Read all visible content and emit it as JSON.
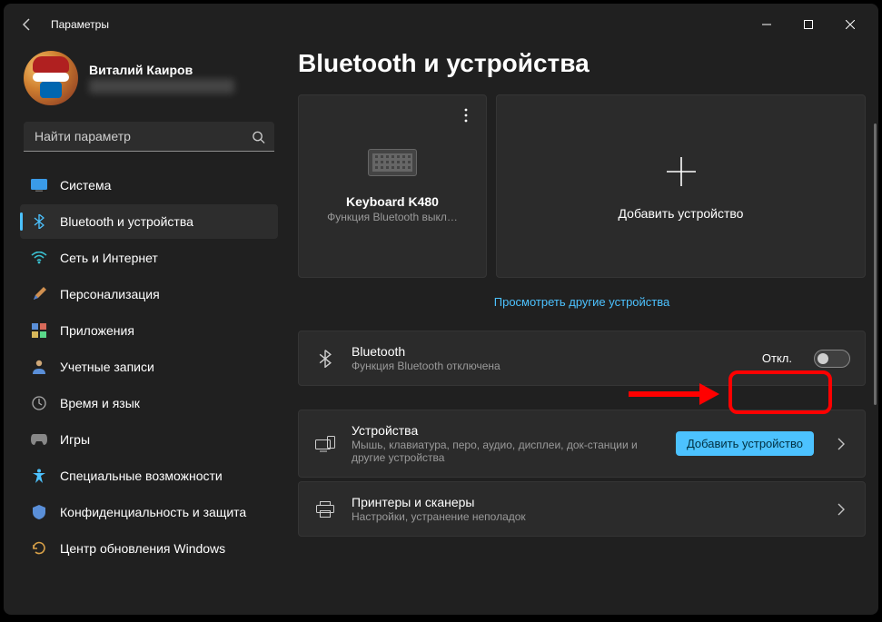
{
  "titlebar": {
    "title": "Параметры"
  },
  "profile": {
    "name": "Виталий Каиров"
  },
  "search": {
    "placeholder": "Найти параметр"
  },
  "sidebar": {
    "items": [
      {
        "label": "Система"
      },
      {
        "label": "Bluetooth и устройства"
      },
      {
        "label": "Сеть и Интернет"
      },
      {
        "label": "Персонализация"
      },
      {
        "label": "Приложения"
      },
      {
        "label": "Учетные записи"
      },
      {
        "label": "Время и язык"
      },
      {
        "label": "Игры"
      },
      {
        "label": "Специальные возможности"
      },
      {
        "label": "Конфиденциальность и защита"
      },
      {
        "label": "Центр обновления Windows"
      }
    ]
  },
  "page": {
    "title": "Bluetooth и устройства"
  },
  "device_card": {
    "name": "Keyboard K480",
    "sub": "Функция Bluetooth выкл…"
  },
  "add_card": {
    "label": "Добавить устройство"
  },
  "link": {
    "view_more": "Просмотреть другие устройства"
  },
  "bluetooth_row": {
    "title": "Bluetooth",
    "sub": "Функция Bluetooth отключена",
    "state": "Откл."
  },
  "devices_row": {
    "title": "Устройства",
    "sub": "Мышь, клавиатура, перо, аудио, дисплеи, док-станции и другие устройства",
    "button": "Добавить устройство"
  },
  "printers_row": {
    "title": "Принтеры и сканеры",
    "sub": "Настройки, устранение неполадок"
  }
}
